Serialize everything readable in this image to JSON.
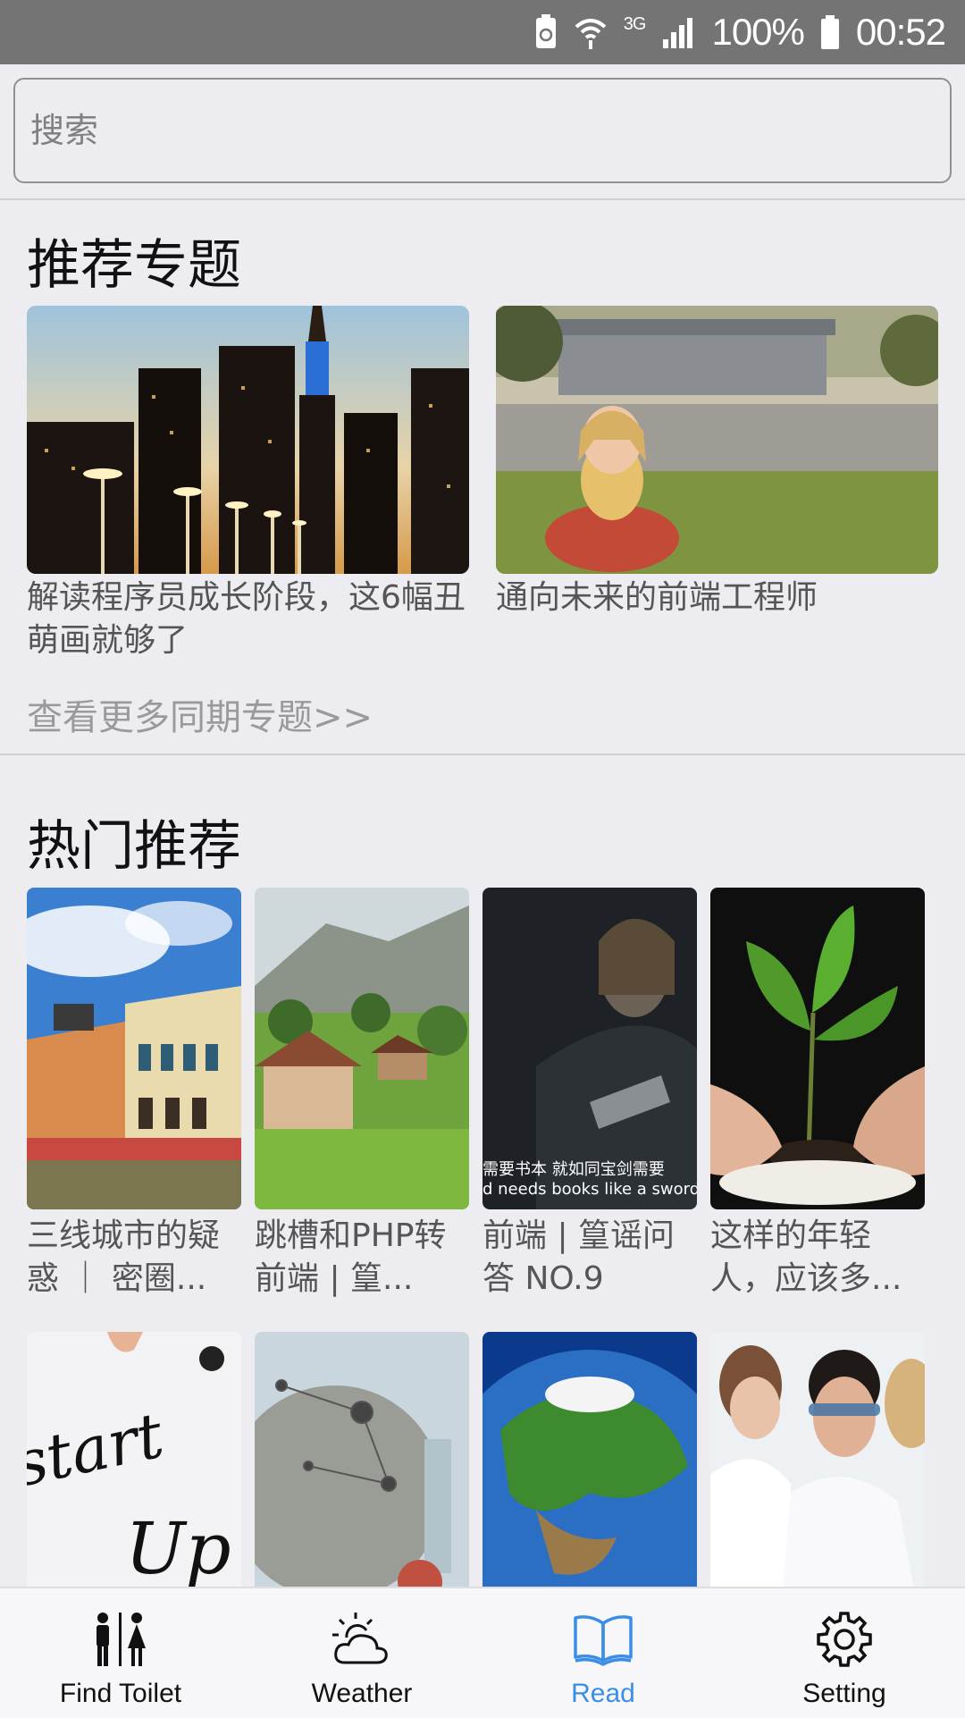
{
  "status_bar": {
    "battery_percent": "100%",
    "time": "00:52",
    "network": "3G"
  },
  "search": {
    "placeholder": "搜索"
  },
  "featured": {
    "title": "推荐专题",
    "items": [
      {
        "caption": "解读程序员成长阶段，这6幅丑萌画就够了",
        "image": "city-skyline-night-photo"
      },
      {
        "caption": "通向未来的前端工程师",
        "image": "girl-on-grass-photo"
      }
    ],
    "more_link": "查看更多同期专题>>"
  },
  "hot": {
    "title": "热门推荐",
    "items": [
      {
        "caption": "三线城市的疑惑 ｜ 密圈...",
        "image": "yellow-building-waterfront-photo"
      },
      {
        "caption": "跳槽和PHP转前端 | 篁...",
        "image": "mountain-village-photo"
      },
      {
        "caption": "前端 | 篁谣问答 NO.9",
        "image": "dark-portrait-still-photo",
        "overlay_text": "需要书本 就如同宝剑需要\nd needs books like a sword needs a w"
      },
      {
        "caption": "这样的年轻人，应该多...",
        "image": "hands-with-sprout-photo"
      },
      {
        "caption": "",
        "image": "start-up-handwriting-photo"
      },
      {
        "caption": "",
        "image": "globe-network-photo"
      },
      {
        "caption": "",
        "image": "earth-globe-photo"
      },
      {
        "caption": "",
        "image": "scientists-lab-photo"
      }
    ]
  },
  "tabbar": {
    "tabs": [
      {
        "label": "Find Toilet",
        "icon": "toilet-people-icon",
        "active": false
      },
      {
        "label": "Weather",
        "icon": "weather-sun-cloud-icon",
        "active": false
      },
      {
        "label": "Read",
        "icon": "open-book-icon",
        "active": true
      },
      {
        "label": "Setting",
        "icon": "gear-icon",
        "active": false
      }
    ],
    "active_color": "#3a8ee6"
  },
  "colors": {
    "status_bar": "#747474",
    "background": "#ececf1",
    "accent": "#3a8ee6"
  }
}
